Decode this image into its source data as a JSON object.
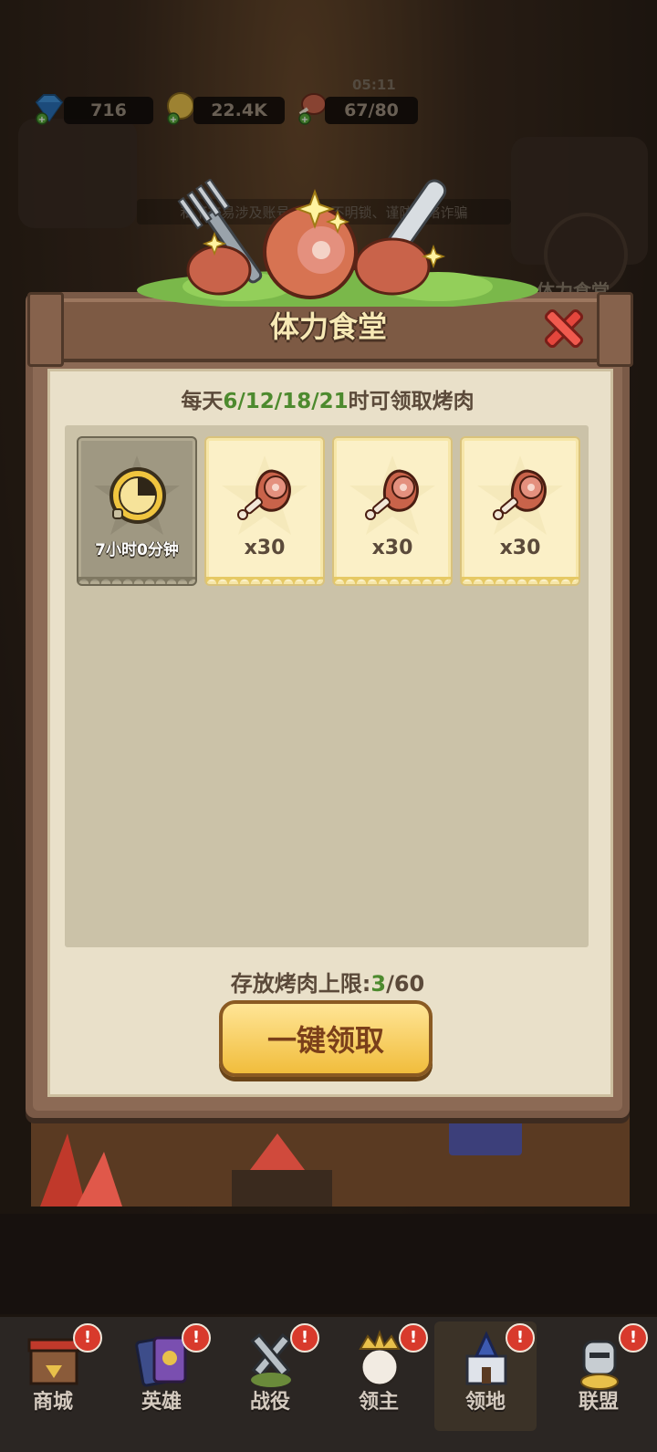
{
  "resources": {
    "gems": "716",
    "gold": "22.4K",
    "stamina": "67/80",
    "stamina_timer": "05:11"
  },
  "background": {
    "notice": "私下交易涉及账号、未来不明锁、谨防网络诈骗",
    "side_shortcut_label": "体力食堂"
  },
  "dialog": {
    "title": "体力食堂",
    "subtitle_prefix": "每天",
    "subtitle_hours": "6/12/18/21",
    "subtitle_suffix": "时可领取烤肉",
    "slots": [
      {
        "state": "locked",
        "timer": "7小时0分钟"
      },
      {
        "state": "ready",
        "quantity": "x30"
      },
      {
        "state": "ready",
        "quantity": "x30"
      },
      {
        "state": "ready",
        "quantity": "x30"
      }
    ],
    "storage_label": "存放烤肉上限:",
    "storage_current": "3",
    "storage_max": "/60",
    "claim_button": "一键领取"
  },
  "nav": {
    "items": [
      {
        "label": "商城",
        "icon": "shop-icon"
      },
      {
        "label": "英雄",
        "icon": "hero-cards-icon"
      },
      {
        "label": "战役",
        "icon": "battle-swords-icon"
      },
      {
        "label": "领主",
        "icon": "lord-crown-icon"
      },
      {
        "label": "领地",
        "icon": "castle-icon",
        "active": true
      },
      {
        "label": "联盟",
        "icon": "alliance-knight-icon"
      }
    ]
  },
  "colors": {
    "accent_green": "#4d8a2e",
    "title_text": "#f7e9b5",
    "button_gold": "#f1bd3c",
    "badge_red": "#d83a2c"
  }
}
